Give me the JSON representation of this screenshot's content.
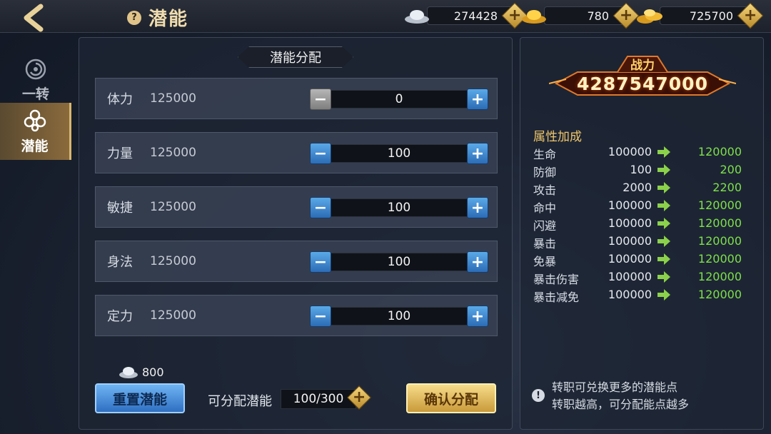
{
  "header": {
    "title": "潜能",
    "currencies": [
      {
        "icon": "silver-ingot-icon",
        "amount": "274428"
      },
      {
        "icon": "gold-ingot-icon",
        "amount": "780"
      },
      {
        "icon": "gold-stack-icon",
        "amount": "725700"
      }
    ]
  },
  "sidebar": {
    "items": [
      {
        "label": "一转",
        "icon": "swirl-icon",
        "active": false
      },
      {
        "label": "潜能",
        "icon": "knot-icon",
        "active": true
      }
    ]
  },
  "potential": {
    "section_title": "潜能分配",
    "rows": [
      {
        "name": "体力",
        "value": "125000",
        "alloc": "0",
        "minus_disabled": true
      },
      {
        "name": "力量",
        "value": "125000",
        "alloc": "100",
        "minus_disabled": false
      },
      {
        "name": "敏捷",
        "value": "125000",
        "alloc": "100",
        "minus_disabled": false
      },
      {
        "name": "身法",
        "value": "125000",
        "alloc": "100",
        "minus_disabled": false
      },
      {
        "name": "定力",
        "value": "125000",
        "alloc": "100",
        "minus_disabled": false
      }
    ],
    "reset_cost": "800",
    "reset_label": "重置潜能",
    "available_label": "可分配潜能",
    "available_value": "100/300",
    "confirm_label": "确认分配"
  },
  "power": {
    "label": "战力",
    "value": "4287547000"
  },
  "attributes": {
    "title": "属性加成",
    "rows": [
      {
        "name": "生命",
        "old": "100000",
        "new": "120000"
      },
      {
        "name": "防御",
        "old": "100",
        "new": "200"
      },
      {
        "name": "攻击",
        "old": "2000",
        "new": "2200"
      },
      {
        "name": "命中",
        "old": "100000",
        "new": "120000"
      },
      {
        "name": "闪避",
        "old": "100000",
        "new": "120000"
      },
      {
        "name": "暴击",
        "old": "100000",
        "new": "120000"
      },
      {
        "name": "免暴",
        "old": "100000",
        "new": "120000"
      },
      {
        "name": "暴击伤害",
        "old": "100000",
        "new": "120000"
      },
      {
        "name": "暴击减免",
        "old": "100000",
        "new": "120000"
      }
    ]
  },
  "tip": {
    "line1": "转职可兑换更多的潜能点",
    "line2": "转职越高，可分配能点越多"
  },
  "colors": {
    "accent_gold": "#f0c66a",
    "increase_green": "#7ee04a",
    "button_blue": "#2f6fc2"
  }
}
